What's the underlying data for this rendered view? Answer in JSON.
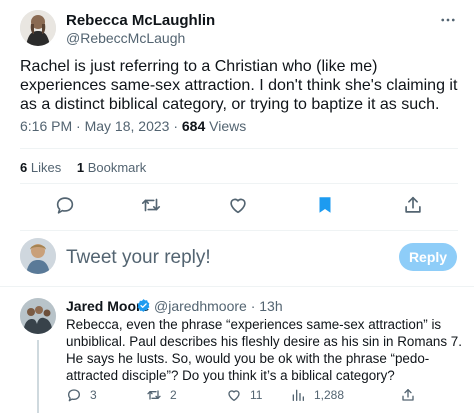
{
  "tweet": {
    "author_name": "Rebecca McLaughlin",
    "author_handle": "@RebeccMcLaugh",
    "text": "Rachel is just referring to a Christian who (like me) experiences same-sex attraction. I don't think she's claiming it as a distinct biblical category, or trying to baptize it as such.",
    "time": "6:16 PM",
    "date": "May 18, 2023",
    "views_count": "684",
    "views_label": "Views",
    "likes_count": "6",
    "likes_label": "Likes",
    "bookmarks_count": "1",
    "bookmarks_label": "Bookmark"
  },
  "actions": {
    "icons": [
      "reply-icon",
      "retweet-icon",
      "like-icon",
      "bookmark-icon",
      "share-icon"
    ],
    "bookmark_active_color": "#1d9bf0"
  },
  "compose": {
    "placeholder": "Tweet your reply!",
    "button_label": "Reply",
    "button_color": "#8ecdf8"
  },
  "reply": {
    "author_name": "Jared Moore",
    "author_handle": "@jaredhmoore",
    "time": "13h",
    "verified_color": "#1d9bf0",
    "text": "Rebecca, even the phrase “experiences same-sex attraction” is unbiblical. Paul describes his fleshly desire as his sin in Romans 7. He says he lusts. So, would you be ok with the phrase “pedo-attracted disciple”? Do you think it’s a biblical category?",
    "replies_count": "3",
    "retweets_count": "2",
    "likes_count": "11",
    "views_count": "1,288"
  },
  "colors": {
    "text_primary": "#0f1419",
    "text_secondary": "#536471",
    "divider": "#eff3f4",
    "accent": "#1d9bf0"
  }
}
